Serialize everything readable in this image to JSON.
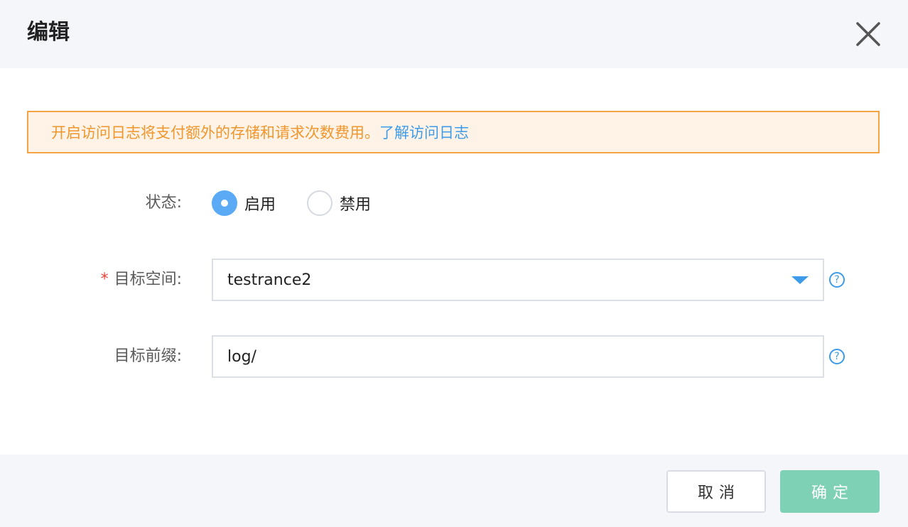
{
  "dialog": {
    "title": "编辑",
    "close_icon": "close-icon"
  },
  "notice": {
    "text": "开启访问日志将支付额外的存储和请求次数费用。",
    "link": "了解访问日志"
  },
  "form": {
    "status": {
      "label": "状态:",
      "options": [
        {
          "label": "启用",
          "selected": true
        },
        {
          "label": "禁用",
          "selected": false
        }
      ]
    },
    "target_bucket": {
      "required_mark": "*",
      "label": "目标空间:",
      "value": "testrance2",
      "arrow_icon": "triangle-down-icon",
      "help_icon": "question-circle-icon",
      "help_glyph": "?"
    },
    "target_prefix": {
      "label": "目标前缀:",
      "value": "log/",
      "help_icon": "question-circle-icon",
      "help_glyph": "?"
    }
  },
  "footer": {
    "cancel_label": "取消",
    "ok_label": "确定"
  },
  "colors": {
    "accent": "#5aaaf5",
    "link": "#3d9be9",
    "warning_text": "#f0962d",
    "warning_border": "#f5a445",
    "warning_bg": "#fff3e7",
    "required": "#e5443a",
    "ok_button": "#7fd1b5"
  }
}
